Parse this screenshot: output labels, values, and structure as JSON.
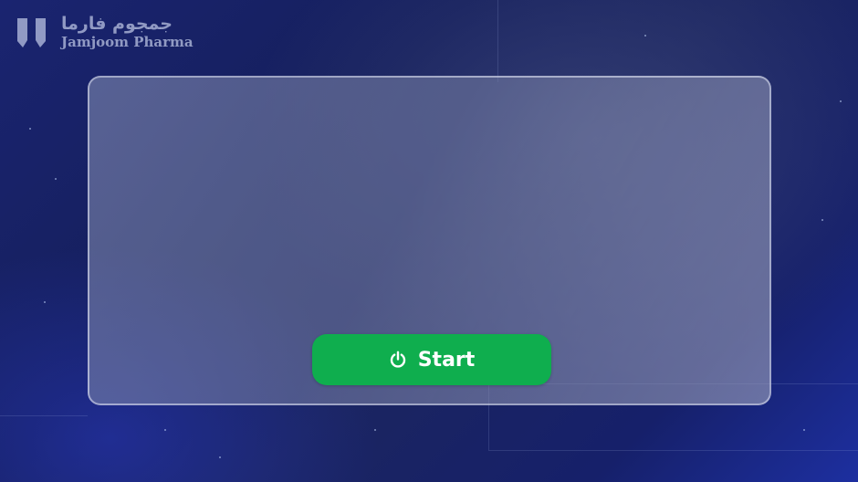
{
  "logo": {
    "arabic_name": "جمجوم فارما",
    "english_name": "Jamjoom Pharma",
    "icon": "jamjoom-logo-mark"
  },
  "start_button": {
    "label": "Start",
    "icon": "power-icon",
    "color": "#0fae4e"
  },
  "theme": {
    "background": "#1a2470",
    "panel": "#8a90b5"
  }
}
